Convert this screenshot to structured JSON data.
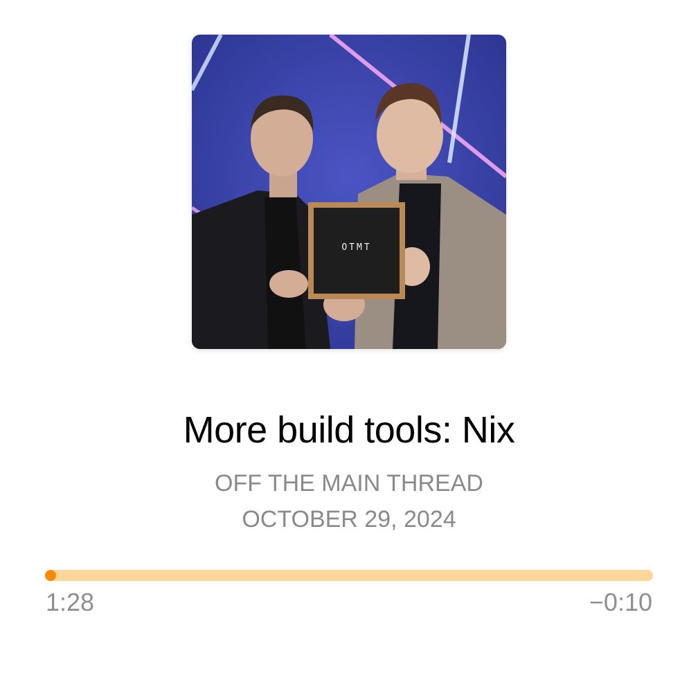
{
  "episode": {
    "title": "More build tools: Nix",
    "podcast": "OFF THE MAIN THREAD",
    "date": "OCTOBER 29, 2024",
    "artwork_sign_text": "OTMT"
  },
  "playback": {
    "elapsed": "1:28",
    "remaining": "−0:10",
    "progress_fraction": 0.0
  },
  "colors": {
    "accent": "#ff8a00",
    "track": "#ffd699",
    "secondary_text": "#8a8a8a",
    "artwork_background": "#3b46a8"
  }
}
